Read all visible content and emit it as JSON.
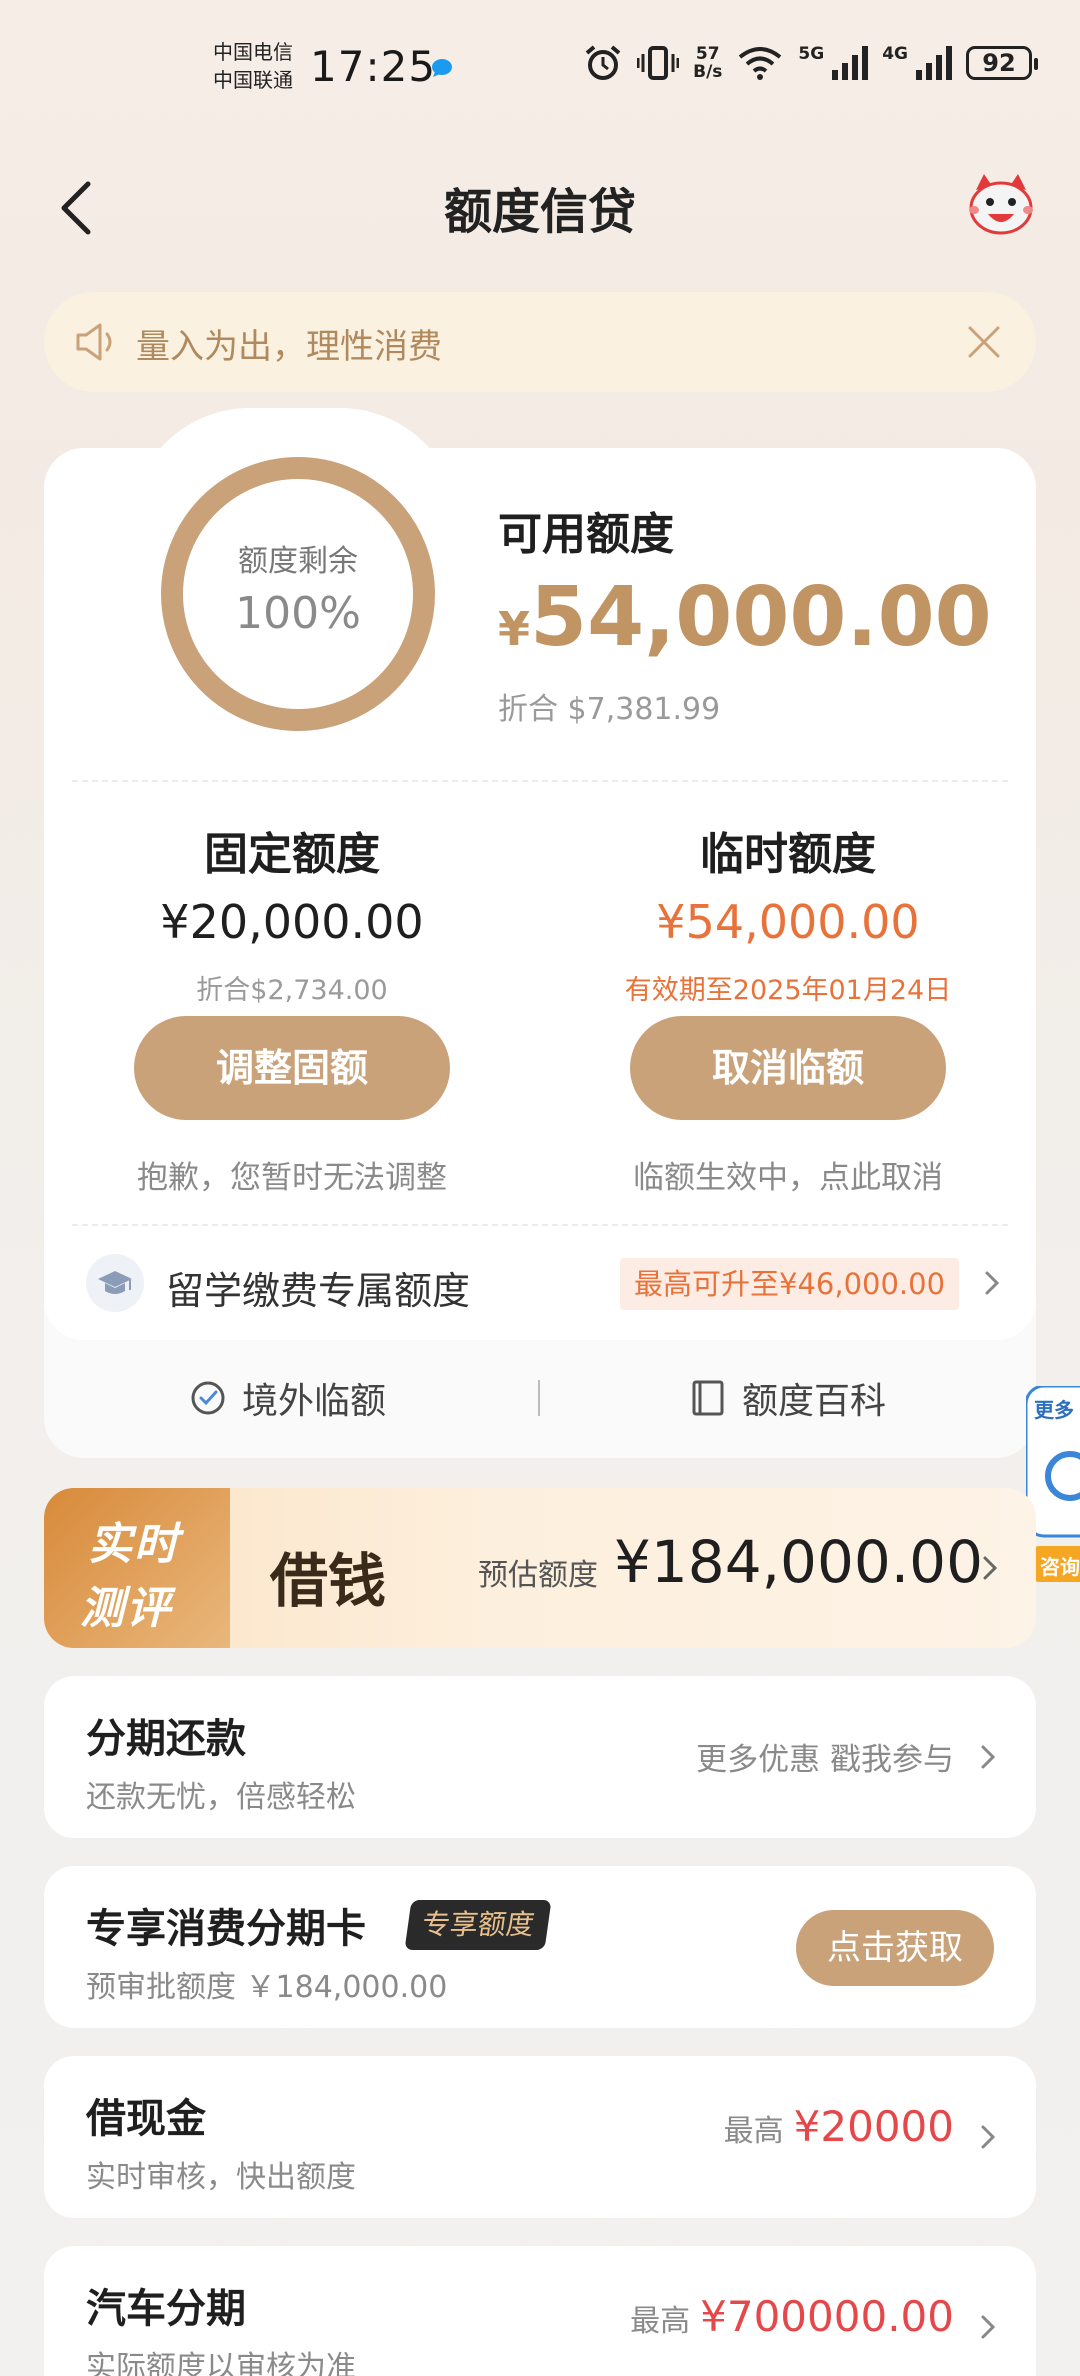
{
  "status_bar": {
    "carrier1": "中国电信",
    "carrier2": "中国联通",
    "time": "17:25",
    "net_speed_value": "57",
    "net_speed_unit": "B/s",
    "network1": "5G",
    "network2": "4G",
    "battery": "92"
  },
  "header": {
    "title": "额度信贷"
  },
  "notice": {
    "text": "量入为出，理性消费"
  },
  "quota": {
    "ring_label": "额度剩余",
    "ring_value": "100%",
    "ring_fraction": 1.0,
    "available_title": "可用额度",
    "available_currency": "¥",
    "available_amount": "54,000.00",
    "available_converted": "折合  $7,381.99",
    "fixed": {
      "title": "固定额度",
      "amount": "¥20,000.00",
      "converted": "折合$2,734.00",
      "button": "调整固额",
      "note": "抱歉，您暂时无法调整"
    },
    "temporary": {
      "title": "临时额度",
      "amount": "¥54,000.00",
      "validity": "有效期至2025年01月24日",
      "button": "取消临额",
      "note": "临额生效中，点此取消"
    },
    "study": {
      "label": "留学缴费专属额度",
      "badge": "最高可升至¥46,000.00"
    },
    "tools": {
      "overseas": "境外临额",
      "encyclopedia": "额度百科"
    }
  },
  "side_widget": {
    "top": "更多",
    "bottom": "咨询"
  },
  "loan_banner": {
    "tag_line1": "实时",
    "tag_line2": "测评",
    "title": "借钱",
    "estimate_label": "预估额度",
    "estimate_value": "¥184,000.00"
  },
  "list": [
    {
      "title": "分期还款",
      "subtitle": "还款无忧，倍感轻松",
      "right": "更多优惠 戳我参与"
    },
    {
      "title": "专享消费分期卡",
      "badge": "专享额度",
      "subtitle": "预审批额度 ￥184,000.00",
      "button": "点击获取"
    },
    {
      "title": "借现金",
      "subtitle": "实时审核，快出额度",
      "right_label": "最高",
      "right_value": "¥20000"
    },
    {
      "title": "汽车分期",
      "subtitle": "实际额度以审核为准",
      "right_label": "最高",
      "right_value": "¥700000.00"
    }
  ],
  "colors": {
    "accent_gold": "#c9a27a",
    "amount_gold": "#c19463",
    "temp_orange": "#e8733a",
    "price_red": "#e4484a"
  }
}
